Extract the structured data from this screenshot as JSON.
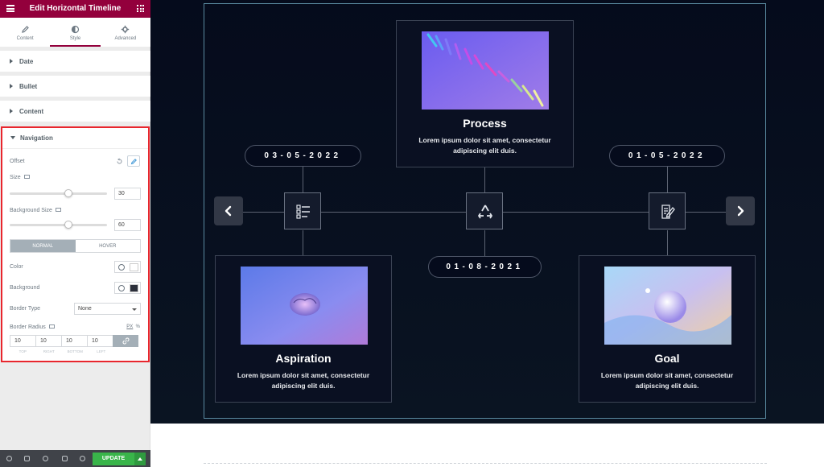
{
  "editor": {
    "title": "Edit Horizontal Timeline",
    "tabs": [
      {
        "label": "Content",
        "icon": "pencil-icon"
      },
      {
        "label": "Style",
        "icon": "half-circle-icon"
      },
      {
        "label": "Advanced",
        "icon": "gear-icon"
      }
    ],
    "active_tab": "Style",
    "sections": [
      "Date",
      "Bullet",
      "Content"
    ],
    "navigation": {
      "heading": "Navigation",
      "offset_label": "Offset",
      "size_label": "Size",
      "size_value": "30",
      "size_fraction": 0.6,
      "bg_size_label": "Background Size",
      "bg_size_value": "60",
      "bg_size_fraction": 0.6,
      "state_tabs": [
        "NORMAL",
        "HOVER"
      ],
      "color_label": "Color",
      "color_value": "#ffffff",
      "background_label": "Background",
      "background_value": "#2b2f3a",
      "border_type_label": "Border Type",
      "border_type_value": "None",
      "border_radius_label": "Border Radius",
      "units": [
        "PX",
        "%"
      ],
      "radius_values": [
        "10",
        "10",
        "10",
        "10"
      ],
      "radius_captions": [
        "TOP",
        "RIGHT",
        "BOTTOM",
        "LEFT"
      ]
    },
    "footer": {
      "update_label": "UPDATE",
      "icons": [
        "settings-icon",
        "layers-icon",
        "history-icon",
        "responsive-icon",
        "preview-icon"
      ]
    }
  },
  "timeline": {
    "cards": [
      {
        "title": "Process",
        "desc": "Lorem ipsum dolor sit amet, consectetur adipiscing elit duis."
      },
      {
        "title": "Aspiration",
        "desc": "Lorem ipsum dolor sit amet, consectetur adipiscing elit duis."
      },
      {
        "title": "Goal",
        "desc": "Lorem ipsum dolor sit amet, consectetur adipiscing elit duis."
      }
    ],
    "dates": [
      "03-05-2022",
      "01-08-2021",
      "01-05-2022"
    ],
    "bullet_icons": [
      "checklist-icon",
      "recycle-icon",
      "document-edit-icon"
    ],
    "colors": {
      "accent": "#93003c",
      "update": "#39b54a",
      "frame": "#5a8aa0"
    }
  }
}
